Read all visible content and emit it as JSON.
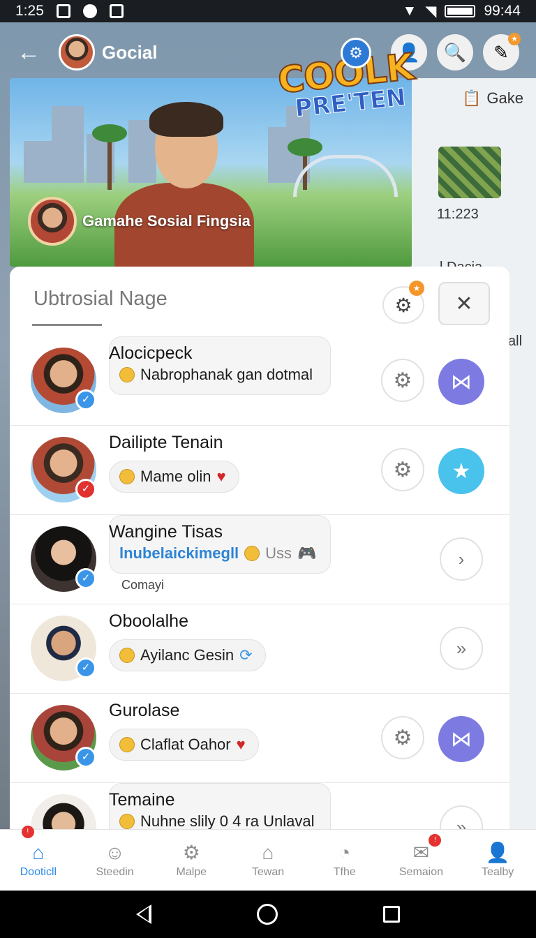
{
  "status_bar": {
    "time_left": "1:25",
    "time_right": "99:44"
  },
  "header": {
    "title": "Gocial"
  },
  "side_panel": {
    "label": "Gake",
    "time": "11:223",
    "frag_1": "l Dacia",
    "frag_2": "all"
  },
  "banner": {
    "logo_line_1": "COOLK",
    "logo_line_2": "PRE'TEN",
    "caption": "Gamahe Sosial Fingsia"
  },
  "sheet": {
    "title": "Ubtrosial Nage"
  },
  "rows": [
    {
      "name": "Alocicpeck",
      "status": "Nabrophanak gan dotmal"
    },
    {
      "name": "Dailipte Tenain",
      "status": "Mame olin"
    },
    {
      "name": "Wangine Tisas",
      "status_link": "lnubelaickimegll",
      "status_extra": "Uss",
      "status_sub": "Comayi"
    },
    {
      "name": "Oboolalhe",
      "status": "Ayilanc Gesin"
    },
    {
      "name": "Gurolase",
      "status": "Claflat Oahor"
    },
    {
      "name": "Temaine",
      "status": "Nuhne slily 0 4 ra Unlaval"
    }
  ],
  "bottom_nav": [
    "Dooticll",
    "Steedin",
    "Malpe",
    "Tewan",
    "Tfhe",
    "Semaion",
    "Tealby"
  ],
  "colors": {
    "accent": "#2c8ae8",
    "purple_action": "#7d7be2",
    "teal_action": "#49c2ec",
    "badge_orange": "#f5962b",
    "badge_red": "#e3322f"
  }
}
